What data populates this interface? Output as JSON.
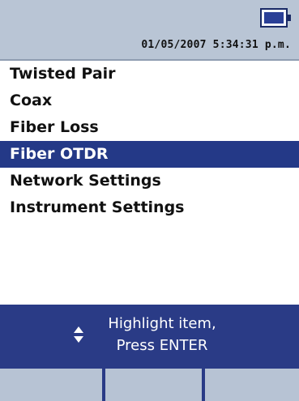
{
  "status": {
    "datetime": "01/05/2007 5:34:31 p.m.",
    "battery_icon": "battery-full-icon"
  },
  "menu": {
    "items": [
      {
        "label": "Twisted Pair",
        "selected": false
      },
      {
        "label": "Coax",
        "selected": false
      },
      {
        "label": "Fiber Loss",
        "selected": false
      },
      {
        "label": "Fiber OTDR",
        "selected": true
      },
      {
        "label": "Network Settings",
        "selected": false
      },
      {
        "label": "Instrument Settings",
        "selected": false
      }
    ]
  },
  "help": {
    "line1": "Highlight item,",
    "line2": "Press ENTER",
    "icon": "up-down-arrows-icon"
  },
  "softkeys": [
    {
      "label": ""
    },
    {
      "label": ""
    },
    {
      "label": ""
    }
  ],
  "colors": {
    "status_bar": "#b9c5d5",
    "selection": "#243987",
    "help_bar": "#2a3b86",
    "softkey": "#b7c3d4"
  }
}
